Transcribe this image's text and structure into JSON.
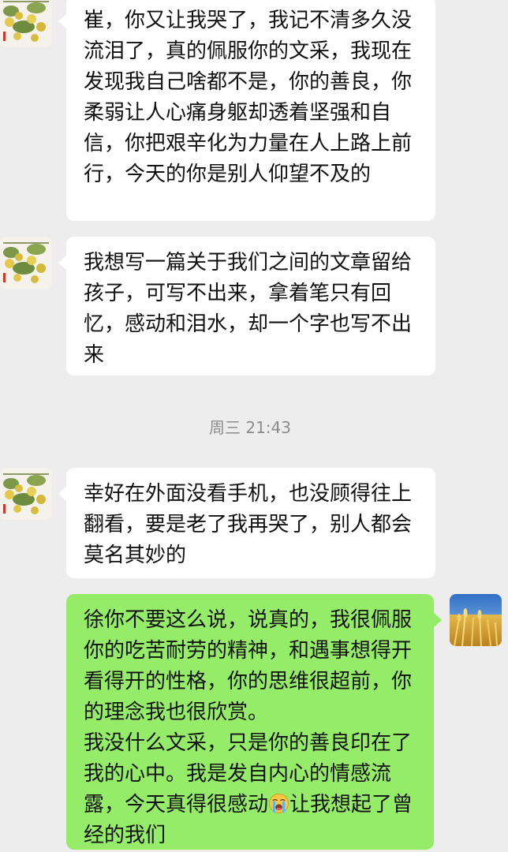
{
  "messages": [
    {
      "text": "崔，你又让我哭了，我记不清多久没流泪了，真的佩服你的文采，我现在发现我自己啥都不是，你的善良，你柔弱让人心痛身躯却透着坚强和自信，你把艰辛化为力量在人上路上前行，今天的你是别人仰望不及的"
    },
    {
      "text": "我想写一篇关于我们之间的文章留给孩子，可写不出来，拿着笔只有回忆，感动和泪水，却一个字也写不出来"
    },
    {
      "text": "幸好在外面没看手机，也没顾得往上翻看，要是老了我再哭了，别人都会莫名其妙的"
    },
    {
      "text_p1": "徐你不要这么说，说真的，我很佩服你的吃苦耐劳的精神，和遇事想得开看得开的性格，你的思维很超前，你的理念我也很欣赏。",
      "text_p2_before": "我没什么文采，只是你的善良印在了我的心中。我是发自内心的情感流露，今天真得很感动",
      "emoji": "loudly-crying-face",
      "text_p2_after": "让我想起了曾经的我们"
    }
  ],
  "timestamp": "周三 21:43",
  "colors": {
    "background": "#ededed",
    "incoming_bubble": "#ffffff",
    "outgoing_bubble": "#95ec69",
    "timestamp_text": "#8c8c8c"
  },
  "avatars": {
    "contact": "pear-tree-avatar",
    "self": "wheat-field-avatar"
  }
}
